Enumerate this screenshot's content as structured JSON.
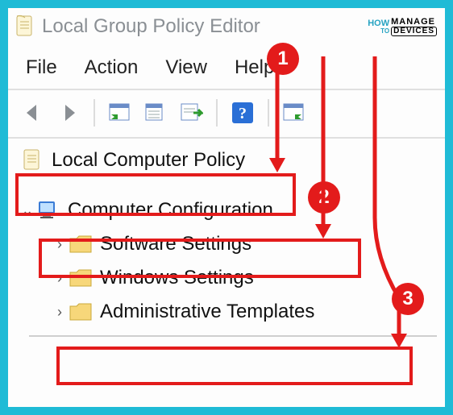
{
  "window": {
    "title": "Local Group Policy Editor"
  },
  "branding": {
    "how": "HOW",
    "to": "TO",
    "manage": "MANAGE",
    "devices": "DEVICES"
  },
  "menu": {
    "file": "File",
    "action": "Action",
    "view": "View",
    "help": "Help"
  },
  "toolbar_icons": {
    "back": "back-arrow",
    "forward": "forward-arrow",
    "console_tree": "show-hide-tree",
    "export": "export-list",
    "properties": "properties",
    "help": "help",
    "action_pane": "action-pane"
  },
  "tree": {
    "root": {
      "label": "Local Computer Policy"
    },
    "computer_config": {
      "label": "Computer Configuration"
    },
    "software_settings": {
      "label": "Software Settings"
    },
    "windows_settings": {
      "label": "Windows Settings"
    },
    "admin_templates": {
      "label": "Administrative Templates"
    }
  },
  "annotations": {
    "badge1": "1",
    "badge2": "2",
    "badge3": "3"
  }
}
